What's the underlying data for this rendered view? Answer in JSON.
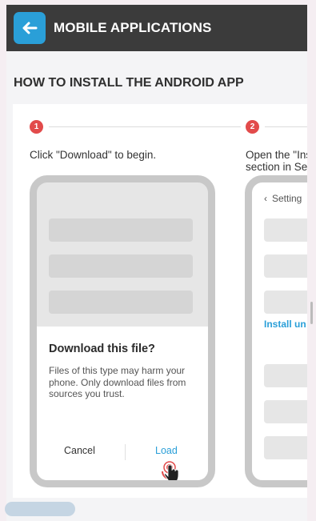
{
  "header": {
    "title": "MOBILE APPLICATIONS",
    "back_icon": "arrow-left-icon",
    "accent_color": "#2a9fd8",
    "bar_color": "#3b3b3b"
  },
  "section": {
    "title": "HOW TO INSTALL THE ANDROID APP"
  },
  "steps": [
    {
      "number": "1",
      "description": "Click \"Download\" to begin.",
      "dialog": {
        "title": "Download this file?",
        "body": "Files of this type may harm your phone. Only download files from sources you trust.",
        "cancel_label": "Cancel",
        "load_label": "Load"
      }
    },
    {
      "number": "2",
      "description_line1": "Open the \"Ins",
      "description_line2": "section in Se",
      "screen": {
        "header_label": "Setting",
        "link_label": "Install un"
      }
    }
  ],
  "colors": {
    "step_badge": "#e24b4b",
    "link": "#2a9fd8"
  }
}
